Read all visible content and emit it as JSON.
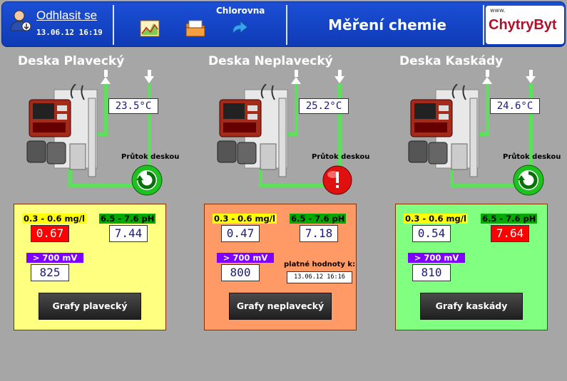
{
  "header": {
    "logout_label": "Odhlasit se",
    "datetime": "13.06.12  16:19",
    "nav_chlorovna": "Chlorovna",
    "title": "Měření chemie",
    "brand_www": "www.",
    "brand_name": "ChytryByt",
    "icons": [
      "user-icon",
      "chart-icon",
      "folder-icon",
      "refresh-icon"
    ]
  },
  "boards": [
    {
      "title": "Deska Plavecký",
      "temperature": "23.5°C",
      "flow_label": "Průtok deskou",
      "flow_status": "ok",
      "chlorine_label": "0.3 - 0.6 mg/l",
      "chlorine_value": "0.67",
      "chlorine_alarm": true,
      "ph_label": "6.5 - 7.6 pH",
      "ph_value": "7.44",
      "ph_alarm": false,
      "redox_label": "> 700 mV",
      "redox_value": "825",
      "button_label": "Grafy plavecký",
      "panel_color": "#ffff80"
    },
    {
      "title": "Deska Neplavecký",
      "temperature": "25.2°C",
      "flow_label": "Průtok deskou",
      "flow_status": "alarm",
      "chlorine_label": "0.3 - 0.6 mg/l",
      "chlorine_value": "0.47",
      "chlorine_alarm": false,
      "ph_label": "6.5 - 7.6 pH",
      "ph_value": "7.18",
      "ph_alarm": false,
      "redox_label": "> 700 mV",
      "redox_value": "800",
      "valid_label": "platné hodnoty k:",
      "valid_time": "13.06.12  16:16",
      "button_label": "Grafy neplavecký",
      "panel_color": "#ff9966"
    },
    {
      "title": "Deska Kaskády",
      "temperature": "24.6°C",
      "flow_label": "Průtok deskou",
      "flow_status": "ok",
      "chlorine_label": "0.3 - 0.6 mg/l",
      "chlorine_value": "0.54",
      "chlorine_alarm": false,
      "ph_label": "6.5 - 7.6 pH",
      "ph_value": "7.64",
      "ph_alarm": true,
      "redox_label": "> 700 mV",
      "redox_value": "810",
      "button_label": "Grafy kaskády",
      "panel_color": "#80ff80"
    }
  ],
  "colors": {
    "chlorine_label_bg": "#ffff00",
    "ph_label_bg": "#00aa00",
    "redox_label_bg": "#8000ff",
    "alarm_bg": "#ff0000",
    "ok_bg": "#ffffff",
    "pipe": "#5ee05e"
  }
}
